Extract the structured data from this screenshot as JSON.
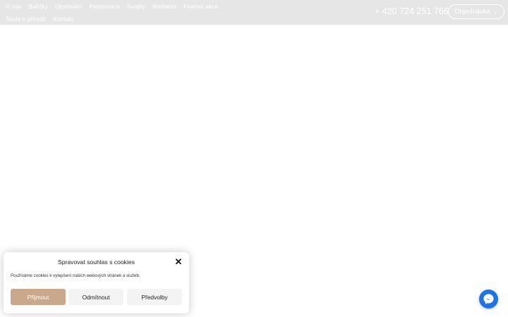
{
  "nav": {
    "row1": [
      "O nás",
      "Balíčky",
      "Ubytování",
      "Restaurace",
      "Svatby",
      "Wellness",
      "Firemní akce"
    ],
    "row2": [
      "Škola v přírodě",
      "Kontakt"
    ]
  },
  "header": {
    "phone": "+ 420 724 251 766",
    "order_label": "Objednávka",
    "bg_color": "#e6e6e6"
  },
  "cookie": {
    "title": "Spravovat souhlas s cookies",
    "text": "Používáme cookies k vylepšení našich webových stránek a služeb.",
    "accept_label": "Přijmout",
    "deny_label": "Odmítnout",
    "prefs_label": "Předvolby",
    "accent_color": "#c9a88b"
  },
  "chat": {
    "icon": "messenger-icon",
    "color": "#1d74e8"
  }
}
